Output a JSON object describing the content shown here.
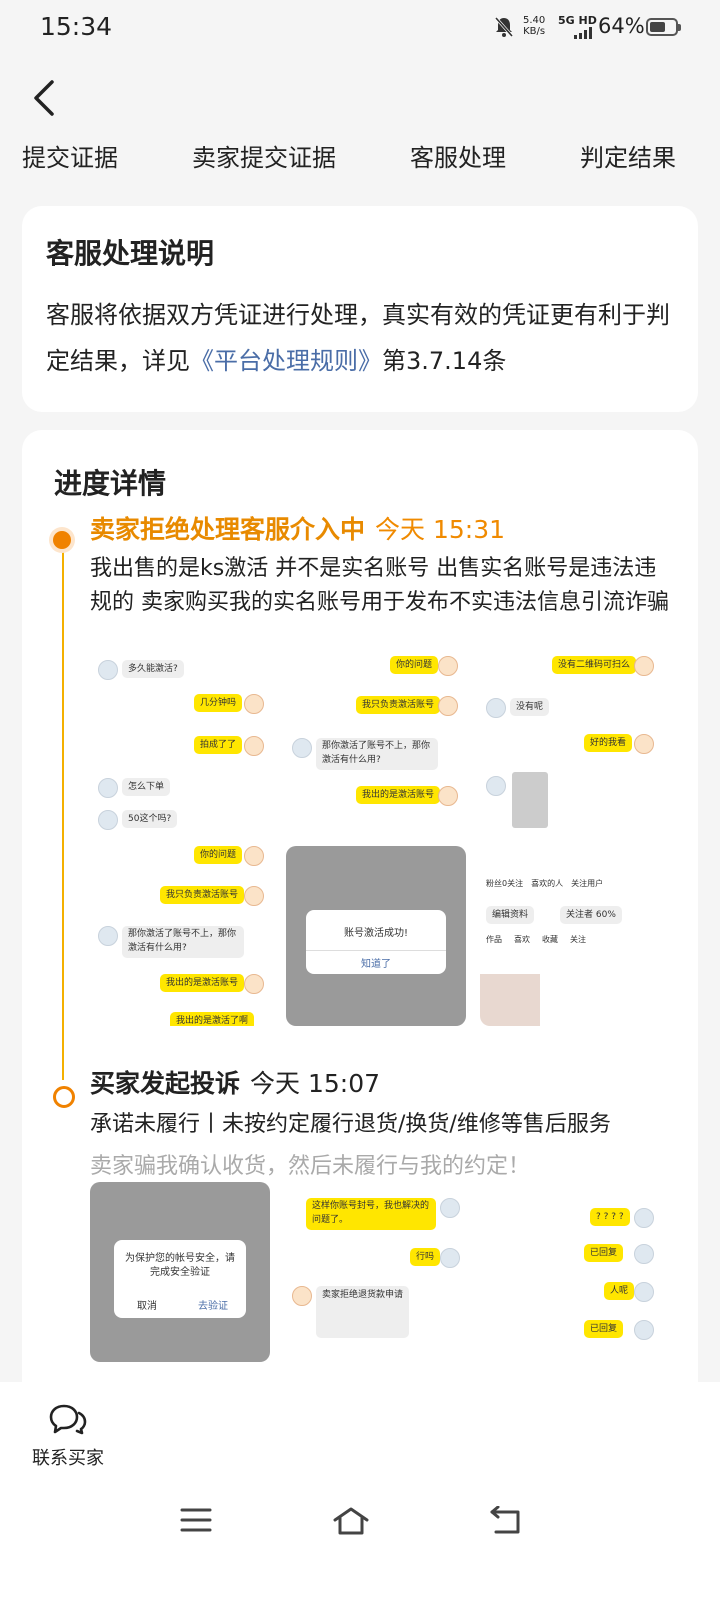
{
  "status": {
    "time": "15:34",
    "speed_value": "5.40",
    "speed_unit": "KB/s",
    "network": "5G HD",
    "battery": "64%",
    "battery_level": 0.64
  },
  "steps": [
    "提交证据",
    "卖家提交证据",
    "客服处理",
    "判定结果"
  ],
  "notice": {
    "title": "客服处理说明",
    "text_before": "客服将依据双方凭证进行处理，真实有效的凭证更有利于判定结果，详见",
    "link": "《平台处理规则》",
    "text_after": "第3.7.14条"
  },
  "progress": {
    "title": "进度详情",
    "events": [
      {
        "title": "卖家拒绝处理客服介入中",
        "time": "今天 15:31",
        "text": "我出售的是ks激活 并不是实名账号 出售实名账号是违法违规的 卖家购买我的实名账号用于发布不实违法信息引流诈骗"
      },
      {
        "title": "买家发起投诉",
        "time": "今天 15:07",
        "reason": "承诺未履行丨未按约定履行退货/换货/维修等售后服务",
        "text": "卖家骗我确认收货，然后未履行与我的约定！"
      }
    ]
  },
  "thumbs": {
    "t1": [
      "多久能激活?",
      "几分钟吗",
      "拍成了了",
      "怎么下单",
      "50这个吗?"
    ],
    "t2": [
      "你的问题",
      "我只负责激活账号",
      "那你激活了账号不上，那你激活有什么用?",
      "我出的是激活账号"
    ],
    "t3": [
      "没有二维码可扫么",
      "没有呢",
      "好的我看"
    ],
    "t4": [
      "你的问题",
      "我只负责激活账号",
      "那你激活了账号不上，那你激活有什么用?",
      "我出的是激活账号",
      "我出的是激活了啊"
    ],
    "t5_dialog": "账号激活成功!",
    "t5_button": "知道了",
    "t6": [
      "粉丝0关注",
      "喜欢的人",
      "关注用户",
      "编辑资料",
      "关注者 60%",
      "作品",
      "喜欢",
      "收藏",
      "关注"
    ],
    "t7_dialog": "为保护您的帐号安全，请完成安全验证",
    "t7_cancel": "取消",
    "t7_ok": "去验证",
    "t8": [
      "这样你账号封号，我也解决的问题了。",
      "行吗",
      "卖家拒绝退货款申请"
    ],
    "t9": [
      "? ? ? ?",
      "已回复",
      "人呢",
      "已回复"
    ]
  },
  "bottom": {
    "contact_label": "联系买家"
  },
  "colors": {
    "accent": "#f08200",
    "link": "#4a6da7",
    "timeline": "#f4b000"
  }
}
